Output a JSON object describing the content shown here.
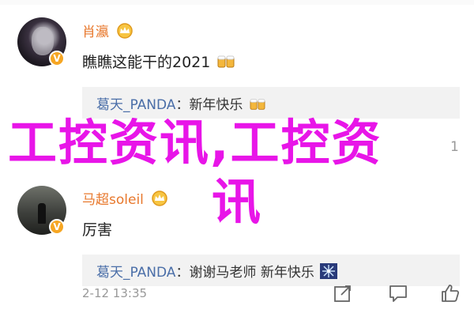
{
  "comments": [
    {
      "user": "肖瀛",
      "text": "瞧瞧这能干的2021",
      "reply": {
        "user": "葛天_PANDA",
        "text": "新年快乐"
      }
    },
    {
      "user": "马超soleil",
      "text": "厉害",
      "reply": {
        "user": "葛天_PANDA",
        "text": "谢谢马老师 新年快乐"
      }
    }
  ],
  "meta": {
    "timestamp": "2-12 13:35"
  },
  "overlay": {
    "line1": "工控资讯,工控资",
    "line2": "讯"
  },
  "side_count": "1",
  "colors": {
    "username": "#e8782c",
    "reply_name": "#4a6ea8",
    "overlay": "#e815e8",
    "verified": "#f6a623"
  }
}
